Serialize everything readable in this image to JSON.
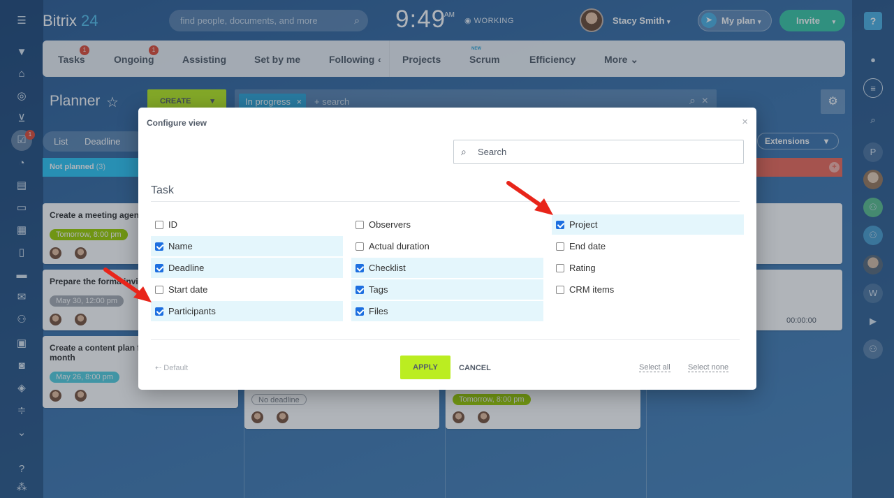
{
  "app": {
    "logo_text": "Bitrix",
    "logo_num": "24"
  },
  "header": {
    "search_placeholder": "find people, documents, and more",
    "clock": "9:49",
    "clock_suffix": "AM",
    "status": "WORKING",
    "user_name": "Stacy Smith",
    "myplan_label": "My plan",
    "invite_label": "Invite"
  },
  "tabs": [
    {
      "label": "Tasks",
      "badge": "1"
    },
    {
      "label": "Ongoing",
      "badge": "1"
    },
    {
      "label": "Assisting"
    },
    {
      "label": "Set by me"
    },
    {
      "label": "Following"
    },
    {
      "label": "Projects"
    },
    {
      "label": "Scrum",
      "tag": "NEW"
    },
    {
      "label": "Efficiency"
    },
    {
      "label": "More"
    }
  ],
  "planner": {
    "title": "Planner",
    "create_label": "CREATE",
    "filter_chip": "In progress",
    "filter_search": "+ search",
    "view_tabs": [
      "List",
      "Deadline"
    ],
    "extensions_label": "Extensions"
  },
  "kanban": {
    "columns": [
      {
        "label": "Not planned",
        "count": "(3)"
      }
    ],
    "cards": [
      {
        "title": "Create a meeting agen",
        "date": "Tomorrow, 8:00 pm"
      },
      {
        "title": "Prepare the forma invi",
        "date": "May 30, 12:00 pm"
      },
      {
        "title": "Create a content plan f",
        "title2": "month",
        "date": "May 26, 8:00 pm"
      },
      {
        "date": "No deadline"
      },
      {
        "date": "Tomorrow, 8:00 pm"
      },
      {
        "time": "00:00:00"
      }
    ]
  },
  "modal": {
    "title": "Configure view",
    "search_placeholder": "Search",
    "section": "Task",
    "columns": [
      [
        {
          "label": "ID",
          "checked": false
        },
        {
          "label": "Name",
          "checked": true
        },
        {
          "label": "Deadline",
          "checked": true
        },
        {
          "label": "Start date",
          "checked": false
        },
        {
          "label": "Participants",
          "checked": true
        }
      ],
      [
        {
          "label": "Observers",
          "checked": false
        },
        {
          "label": "Actual duration",
          "checked": false
        },
        {
          "label": "Checklist",
          "checked": true
        },
        {
          "label": "Tags",
          "checked": true
        },
        {
          "label": "Files",
          "checked": true
        }
      ],
      [
        {
          "label": "Project",
          "checked": true
        },
        {
          "label": "End date",
          "checked": false
        },
        {
          "label": "Rating",
          "checked": false
        },
        {
          "label": "CRM items",
          "checked": false
        }
      ]
    ],
    "default_label": "Default",
    "apply_label": "APPLY",
    "cancel_label": "CANCEL",
    "select_all": "Select all",
    "select_none": "Select none"
  },
  "left_icons": [
    "menu-icon",
    "filter-icon",
    "home-icon",
    "target-icon",
    "cart-icon",
    "tasks-icon",
    "pie-icon",
    "news-icon",
    "chat-icon",
    "calendar-icon",
    "document-icon",
    "drive-icon",
    "mail-icon",
    "group-icon",
    "contact-icon",
    "robot-icon",
    "box-icon",
    "settings-icon",
    "more-icon",
    "help-icon",
    "sitemap-icon"
  ],
  "left_badge": "1",
  "right_avatar_letter_p": "P",
  "right_avatar_letter_w": "W",
  "colors": {
    "accent_green": "#bbed21",
    "accent_blue": "#2fa7d9",
    "checkbox_blue": "#1d6fe0",
    "arrow_red": "#e8251a"
  }
}
